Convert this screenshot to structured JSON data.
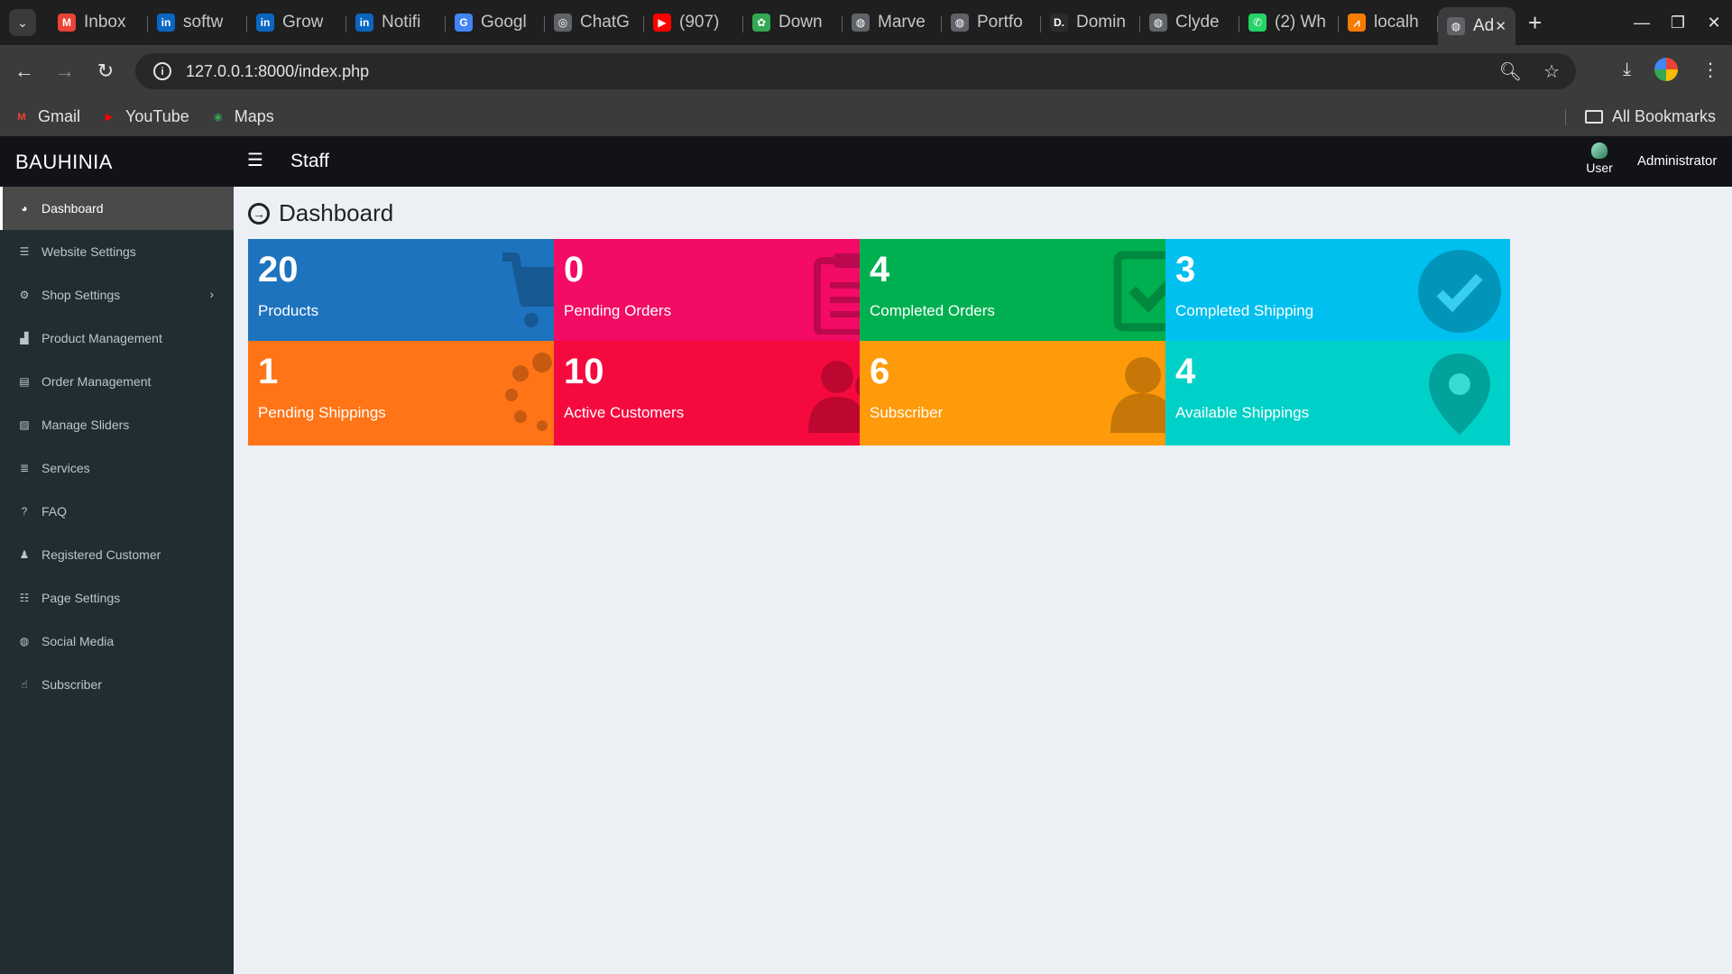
{
  "browser": {
    "tabs": [
      {
        "label": "Inbox",
        "icon": "gmail-icon",
        "color": "#ea4335",
        "glyph": "M"
      },
      {
        "label": "softw",
        "icon": "linkedin-icon",
        "color": "#0a66c2",
        "glyph": "in"
      },
      {
        "label": "Grow",
        "icon": "linkedin-icon",
        "color": "#0a66c2",
        "glyph": "in"
      },
      {
        "label": "Notifi",
        "icon": "linkedin-icon",
        "color": "#0a66c2",
        "glyph": "in"
      },
      {
        "label": "Googl",
        "icon": "google-translate-icon",
        "color": "#4285f4",
        "glyph": "G"
      },
      {
        "label": "ChatG",
        "icon": "chatgpt-icon",
        "color": "#5f6368",
        "glyph": "◎"
      },
      {
        "label": "(907)",
        "icon": "youtube-icon",
        "color": "#ff0000",
        "glyph": "▶"
      },
      {
        "label": "Down",
        "icon": "download-site-icon",
        "color": "#34a853",
        "glyph": "✿"
      },
      {
        "label": "Marve",
        "icon": "globe-icon",
        "color": "#5f6368",
        "glyph": "◍"
      },
      {
        "label": "Portfo",
        "icon": "globe-icon",
        "color": "#5f6368",
        "glyph": "◍"
      },
      {
        "label": "Domin",
        "icon": "d-logo-icon",
        "color": "#2b2b2b",
        "glyph": "D."
      },
      {
        "label": "Clyde",
        "icon": "globe-icon",
        "color": "#5f6368",
        "glyph": "◍"
      },
      {
        "label": "(2) Wh",
        "icon": "whatsapp-icon",
        "color": "#25d366",
        "glyph": "✆"
      },
      {
        "label": "localh",
        "icon": "localhost-icon",
        "color": "#f57c00",
        "glyph": "⩘"
      }
    ],
    "active_tab": {
      "label": "Ad",
      "icon": "globe-icon"
    },
    "url": "127.0.0.1:8000/index.php",
    "bookmarks": [
      {
        "label": "Gmail",
        "icon": "gmail-icon",
        "color": "#ea4335",
        "glyph": "M"
      },
      {
        "label": "YouTube",
        "icon": "youtube-icon",
        "color": "#ff0000",
        "glyph": "▶"
      },
      {
        "label": "Maps",
        "icon": "maps-icon",
        "color": "#34a853",
        "glyph": "◉"
      }
    ],
    "all_bookmarks": "All Bookmarks"
  },
  "app": {
    "brand": "BAUHINIA",
    "section": "Staff",
    "user_label": "User",
    "admin_label": "Administrator"
  },
  "sidebar": {
    "items": [
      {
        "label": "Dashboard",
        "icon": "dashboard-icon",
        "glyph": "◕",
        "active": true
      },
      {
        "label": "Website Settings",
        "icon": "sliders-icon",
        "glyph": "☰"
      },
      {
        "label": "Shop Settings",
        "icon": "cogs-icon",
        "glyph": "⚙",
        "has_submenu": true
      },
      {
        "label": "Product Management",
        "icon": "shopping-bag-icon",
        "glyph": "▟"
      },
      {
        "label": "Order Management",
        "icon": "note-icon",
        "glyph": "▤"
      },
      {
        "label": "Manage Sliders",
        "icon": "image-icon",
        "glyph": "▨"
      },
      {
        "label": "Services",
        "icon": "list-icon",
        "glyph": "≣"
      },
      {
        "label": "FAQ",
        "icon": "question-circle-icon",
        "glyph": "?"
      },
      {
        "label": "Registered Customer",
        "icon": "user-plus-icon",
        "glyph": "♟"
      },
      {
        "label": "Page Settings",
        "icon": "page-list-icon",
        "glyph": "☷"
      },
      {
        "label": "Social Media",
        "icon": "globe-icon",
        "glyph": "◍"
      },
      {
        "label": "Subscriber",
        "icon": "thumbs-up-icon",
        "glyph": "☝"
      }
    ]
  },
  "main": {
    "title": "Dashboard",
    "cards": [
      {
        "value": "20",
        "label": "Products",
        "color": "#1e73be",
        "icon": "shopping-cart-icon"
      },
      {
        "value": "0",
        "label": "Pending Orders",
        "color": "#f30b65",
        "icon": "clipboard-icon"
      },
      {
        "value": "4",
        "label": "Completed Orders",
        "color": "#00b050",
        "icon": "check-square-icon"
      },
      {
        "value": "3",
        "label": "Completed Shipping",
        "color": "#00c0ef",
        "icon": "check-circle-icon"
      },
      {
        "value": "1",
        "label": "Pending Shippings",
        "color": "#ff7417",
        "icon": "spinner-icon"
      },
      {
        "value": "10",
        "label": "Active Customers",
        "color": "#f50a3f",
        "icon": "users-icon"
      },
      {
        "value": "6",
        "label": "Subscriber",
        "color": "#ff9a0a",
        "icon": "user-plus-icon"
      },
      {
        "value": "4",
        "label": "Available Shippings",
        "color": "#00d1c8",
        "icon": "map-marker-icon"
      }
    ]
  }
}
